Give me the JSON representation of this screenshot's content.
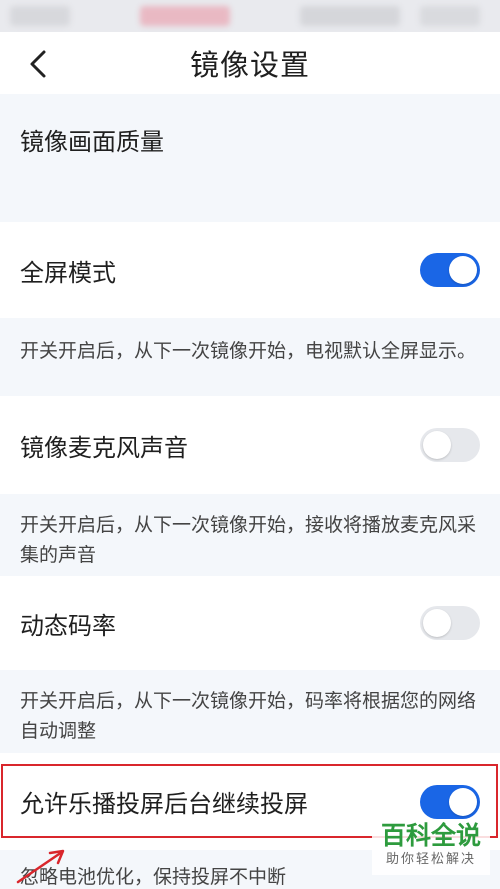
{
  "header": {
    "title": "镜像设置"
  },
  "section": {
    "quality_label": "镜像画面质量"
  },
  "settings": [
    {
      "label": "全屏模式",
      "enabled": true,
      "description": "开关开启后，从下一次镜像开始，电视默认全屏显示。"
    },
    {
      "label": "镜像麦克风声音",
      "enabled": false,
      "description": "开关开启后，从下一次镜像开始，接收将播放麦克风采集的声音"
    },
    {
      "label": "动态码率",
      "enabled": false,
      "description": "开关开启后，从下一次镜像开始，码率将根据您的网络自动调整"
    },
    {
      "label": "允许乐播投屏后台继续投屏",
      "enabled": true,
      "description": "忽略电池优化，保持投屏不中断"
    }
  ],
  "watermark": {
    "main": "百科全说",
    "sub": "助你轻松解决"
  },
  "colors": {
    "toggle_on": "#1a66e6",
    "toggle_off": "#e6e8ec",
    "highlight": "#d9262c",
    "watermark_green": "#2e9b3e"
  },
  "icons": {
    "back": "chevron-left-icon"
  }
}
